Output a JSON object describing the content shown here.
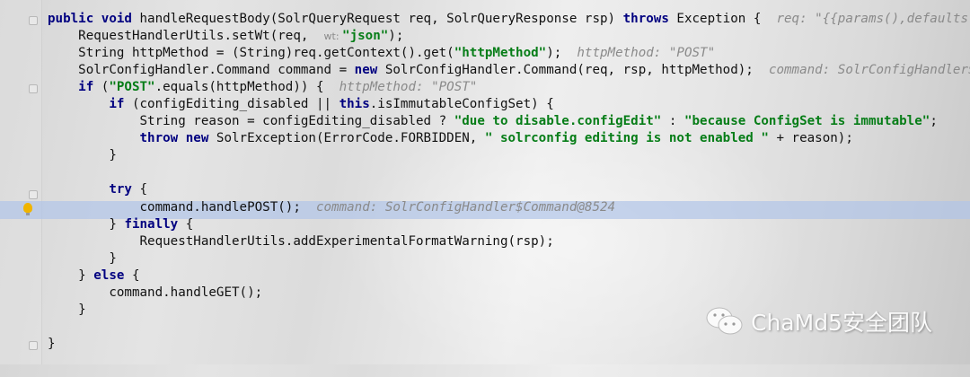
{
  "editor": {
    "lines": [
      {
        "indent": 0,
        "tokens": [
          [
            "k",
            "public void "
          ],
          [
            "p",
            "handleRequestBody(SolrQueryRequest req, SolrQueryResponse rsp) "
          ],
          [
            "k",
            "throws "
          ],
          [
            "p",
            "Exception {  "
          ],
          [
            "h",
            "req: \"{{params(),defaults("
          ]
        ]
      },
      {
        "indent": 1,
        "tokens": [
          [
            "p",
            "RequestHandlerUtils.setWt(req,  "
          ],
          [
            "n",
            "wt: "
          ],
          [
            "s",
            "\"json\""
          ],
          [
            "p",
            ");"
          ]
        ]
      },
      {
        "indent": 1,
        "tokens": [
          [
            "p",
            "String httpMethod = (String)req.getContext().get("
          ],
          [
            "s",
            "\"httpMethod\""
          ],
          [
            "p",
            ");  "
          ],
          [
            "h",
            "httpMethod: \"POST\""
          ]
        ]
      },
      {
        "indent": 1,
        "tokens": [
          [
            "p",
            "SolrConfigHandler.Command command = "
          ],
          [
            "k",
            "new "
          ],
          [
            "p",
            "SolrConfigHandler.Command(req, rsp, httpMethod);  "
          ],
          [
            "h",
            "command: SolrConfigHandler$"
          ]
        ]
      },
      {
        "indent": 1,
        "tokens": [
          [
            "k",
            "if "
          ],
          [
            "p",
            "("
          ],
          [
            "s",
            "\"POST\""
          ],
          [
            "p",
            ".equals(httpMethod)) {  "
          ],
          [
            "h",
            "httpMethod: \"POST\""
          ]
        ]
      },
      {
        "indent": 2,
        "tokens": [
          [
            "k",
            "if "
          ],
          [
            "p",
            "(configEditing_disabled || "
          ],
          [
            "k",
            "this"
          ],
          [
            "p",
            ".isImmutableConfigSet) {"
          ]
        ]
      },
      {
        "indent": 3,
        "tokens": [
          [
            "p",
            "String reason = configEditing_disabled ? "
          ],
          [
            "s",
            "\"due to disable.configEdit\""
          ],
          [
            "p",
            " : "
          ],
          [
            "s",
            "\"because ConfigSet is immutable\""
          ],
          [
            "p",
            ";"
          ]
        ]
      },
      {
        "indent": 3,
        "tokens": [
          [
            "k",
            "throw new "
          ],
          [
            "p",
            "SolrException(ErrorCode.FORBIDDEN, "
          ],
          [
            "s",
            "\" solrconfig editing is not enabled \""
          ],
          [
            "p",
            " + reason);"
          ]
        ]
      },
      {
        "indent": 2,
        "tokens": [
          [
            "p",
            "}"
          ]
        ]
      },
      {
        "indent": 0,
        "tokens": []
      },
      {
        "indent": 2,
        "tokens": [
          [
            "k",
            "try "
          ],
          [
            "p",
            "{"
          ]
        ]
      },
      {
        "indent": 3,
        "tokens": [
          [
            "p",
            "command.handlePOST();  "
          ],
          [
            "h",
            "command: SolrConfigHandler$Command@8524"
          ]
        ]
      },
      {
        "indent": 2,
        "tokens": [
          [
            "p",
            "} "
          ],
          [
            "k",
            "finally "
          ],
          [
            "p",
            "{"
          ]
        ]
      },
      {
        "indent": 3,
        "tokens": [
          [
            "p",
            "RequestHandlerUtils.addExperimentalFormatWarning(rsp);"
          ]
        ]
      },
      {
        "indent": 2,
        "tokens": [
          [
            "p",
            "}"
          ]
        ]
      },
      {
        "indent": 1,
        "tokens": [
          [
            "p",
            "} "
          ],
          [
            "k",
            "else "
          ],
          [
            "p",
            "{"
          ]
        ]
      },
      {
        "indent": 2,
        "tokens": [
          [
            "p",
            "command.handleGET();"
          ]
        ]
      },
      {
        "indent": 1,
        "tokens": [
          [
            "p",
            "}"
          ]
        ]
      },
      {
        "indent": 0,
        "tokens": []
      },
      {
        "indent": 0,
        "tokens": [
          [
            "p",
            "}"
          ]
        ]
      }
    ],
    "current_line_color": "#b0c4e8",
    "breakpoint_icon": "lightbulb-icon"
  },
  "watermark": {
    "icon": "wechat-icon",
    "text": "ChaMd5安全团队"
  }
}
